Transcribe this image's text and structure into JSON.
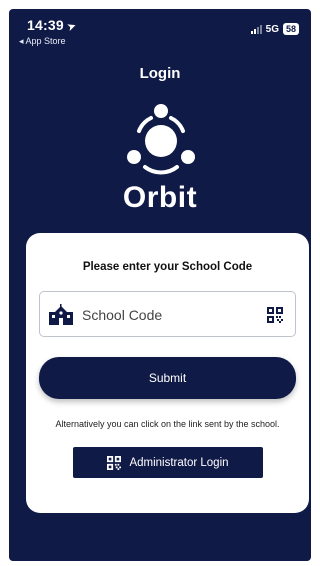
{
  "status_bar": {
    "time": "14:39",
    "back_label": "◂ App Store",
    "network": "5G",
    "battery": "58"
  },
  "header": {
    "title": "Login"
  },
  "brand": {
    "name": "Orbit"
  },
  "form": {
    "heading": "Please enter your School Code",
    "school_code": {
      "value": "",
      "placeholder": "School Code"
    },
    "submit_label": "Submit",
    "alternative_text": "Alternatively you can click on the link sent by the school.",
    "admin_login_label": "Administrator Login"
  },
  "colors": {
    "background": "#0f1a47",
    "card": "#ffffff",
    "accent": "#0f1a47"
  },
  "icons": {
    "location": "location-arrow-icon",
    "school": "school-icon",
    "qr": "qr-code-icon"
  }
}
